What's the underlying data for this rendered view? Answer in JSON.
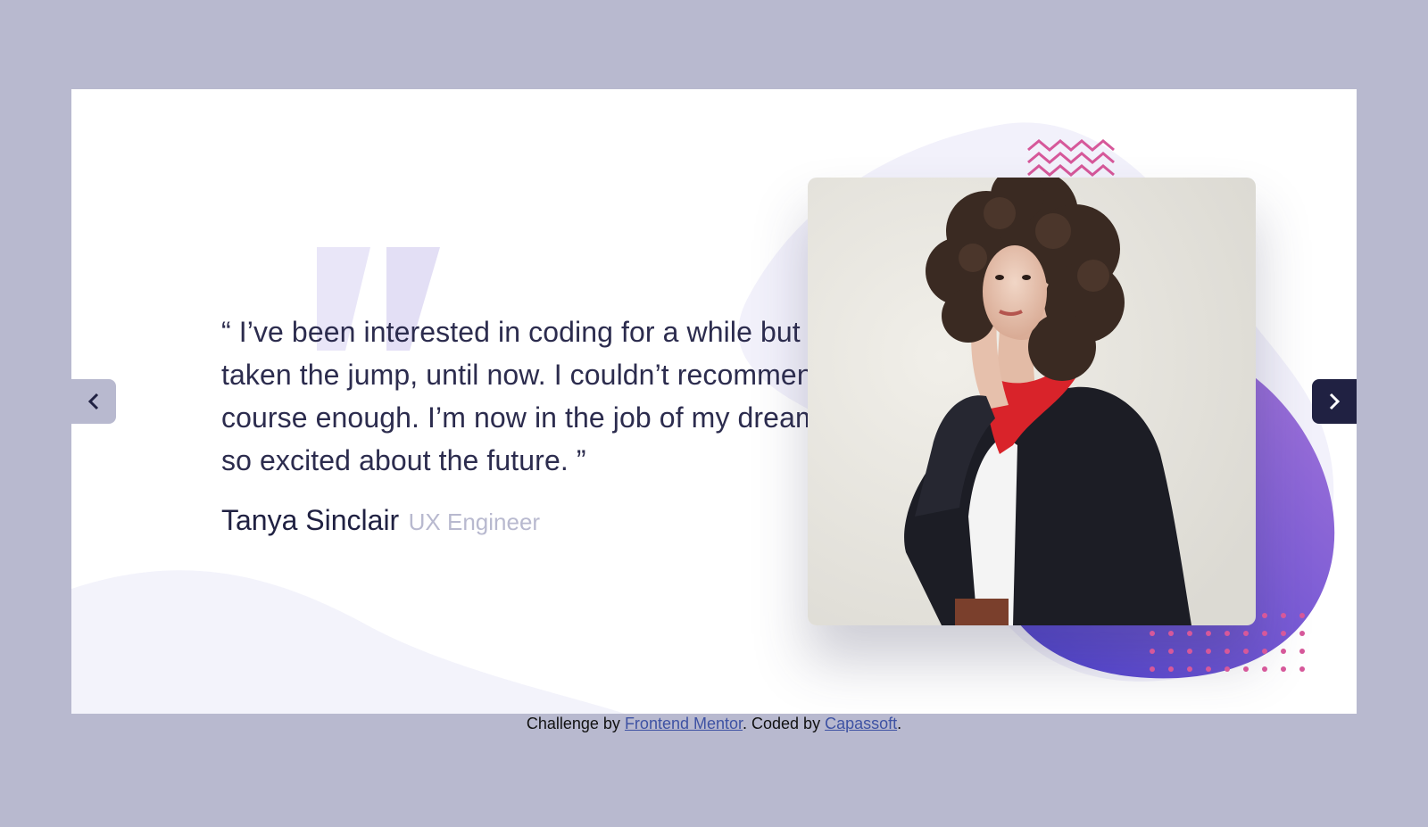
{
  "testimonial": {
    "quote": "“ I’ve been interested in coding for a while but never taken the jump, until now. I couldn’t recommend this course enough. I’m now in the job of my dreams and so excited about the future. ”",
    "author_name": "Tanya Sinclair",
    "author_role": "UX Engineer"
  },
  "navigation": {
    "prev_icon": "chevron-left-icon",
    "next_icon": "chevron-right-icon"
  },
  "attribution": {
    "prefix": "Challenge by ",
    "link1": "Frontend Mentor",
    "middle": ". Coded by ",
    "link2": "Capassoft",
    "suffix": "."
  },
  "colors": {
    "page_bg": "#b8b9cf",
    "card_bg": "#ffffff",
    "text_dark": "#202142",
    "text_muted": "#b8b9cf",
    "blob_purple": "#7b5fd6",
    "blob_light": "#f2f1fb",
    "accent_pink": "#d6589a",
    "quote_mark": "#e6e4f6",
    "nav_active": "#202142"
  }
}
